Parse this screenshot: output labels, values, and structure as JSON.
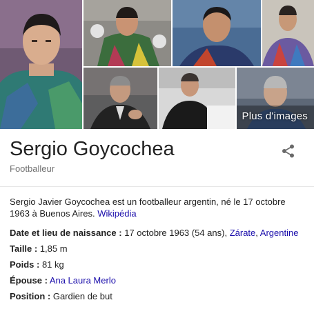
{
  "images": {
    "more_label": "Plus d'images"
  },
  "entity": {
    "name": "Sergio Goycochea",
    "subtitle": "Footballeur"
  },
  "description": {
    "text": "Sergio Javier Goycochea est un footballeur argentin, né le 17 octobre 1963 à Buenos Aires. ",
    "source_link": "Wikipédia"
  },
  "facts": {
    "birth": {
      "label": "Date et lieu de naissance :",
      "value": " 17 octobre 1963 (54 ans), ",
      "link1": "Zárate",
      "sep": ", ",
      "link2": "Argentine"
    },
    "height": {
      "label": "Taille :",
      "value": " 1,85 m"
    },
    "weight": {
      "label": "Poids :",
      "value": " 81 kg"
    },
    "spouse": {
      "label": "Épouse :",
      "link": "Ana Laura Merlo"
    },
    "position": {
      "label": "Position :",
      "value": " Gardien de but"
    }
  },
  "colors": {
    "link": "#1a0dab",
    "subtitle": "#707070"
  },
  "icons": {
    "share": "share-icon"
  }
}
